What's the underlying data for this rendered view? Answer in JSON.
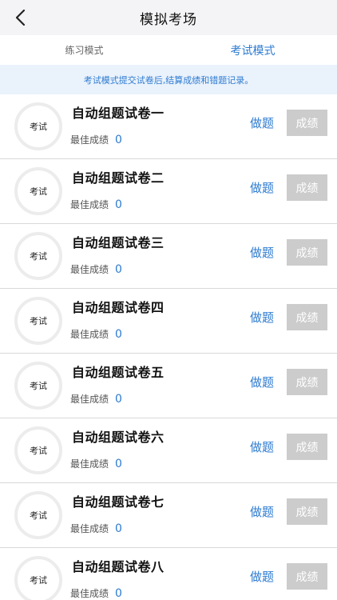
{
  "nav": {
    "title": "模拟考场",
    "back_icon": "chevron-left-icon"
  },
  "tabs": [
    {
      "label": "练习模式",
      "active": false
    },
    {
      "label": "考试模式",
      "active": true
    }
  ],
  "notice": "考试模式提交试卷后,结算成绩和错题记录。",
  "colors": {
    "accent": "#2d7bd0",
    "notice_bg": "#eaf2fc",
    "disabled_button": "#cccccc"
  },
  "papers": [
    {
      "badge": "考试",
      "title": "自动组题试卷一",
      "best_label": "最佳成绩",
      "best_score": "0",
      "do_label": "做题",
      "score_label": "成绩"
    },
    {
      "badge": "考试",
      "title": "自动组题试卷二",
      "best_label": "最佳成绩",
      "best_score": "0",
      "do_label": "做题",
      "score_label": "成绩"
    },
    {
      "badge": "考试",
      "title": "自动组题试卷三",
      "best_label": "最佳成绩",
      "best_score": "0",
      "do_label": "做题",
      "score_label": "成绩"
    },
    {
      "badge": "考试",
      "title": "自动组题试卷四",
      "best_label": "最佳成绩",
      "best_score": "0",
      "do_label": "做题",
      "score_label": "成绩"
    },
    {
      "badge": "考试",
      "title": "自动组题试卷五",
      "best_label": "最佳成绩",
      "best_score": "0",
      "do_label": "做题",
      "score_label": "成绩"
    },
    {
      "badge": "考试",
      "title": "自动组题试卷六",
      "best_label": "最佳成绩",
      "best_score": "0",
      "do_label": "做题",
      "score_label": "成绩"
    },
    {
      "badge": "考试",
      "title": "自动组题试卷七",
      "best_label": "最佳成绩",
      "best_score": "0",
      "do_label": "做题",
      "score_label": "成绩"
    },
    {
      "badge": "考试",
      "title": "自动组题试卷八",
      "best_label": "最佳成绩",
      "best_score": "0",
      "do_label": "做题",
      "score_label": "成绩"
    }
  ]
}
